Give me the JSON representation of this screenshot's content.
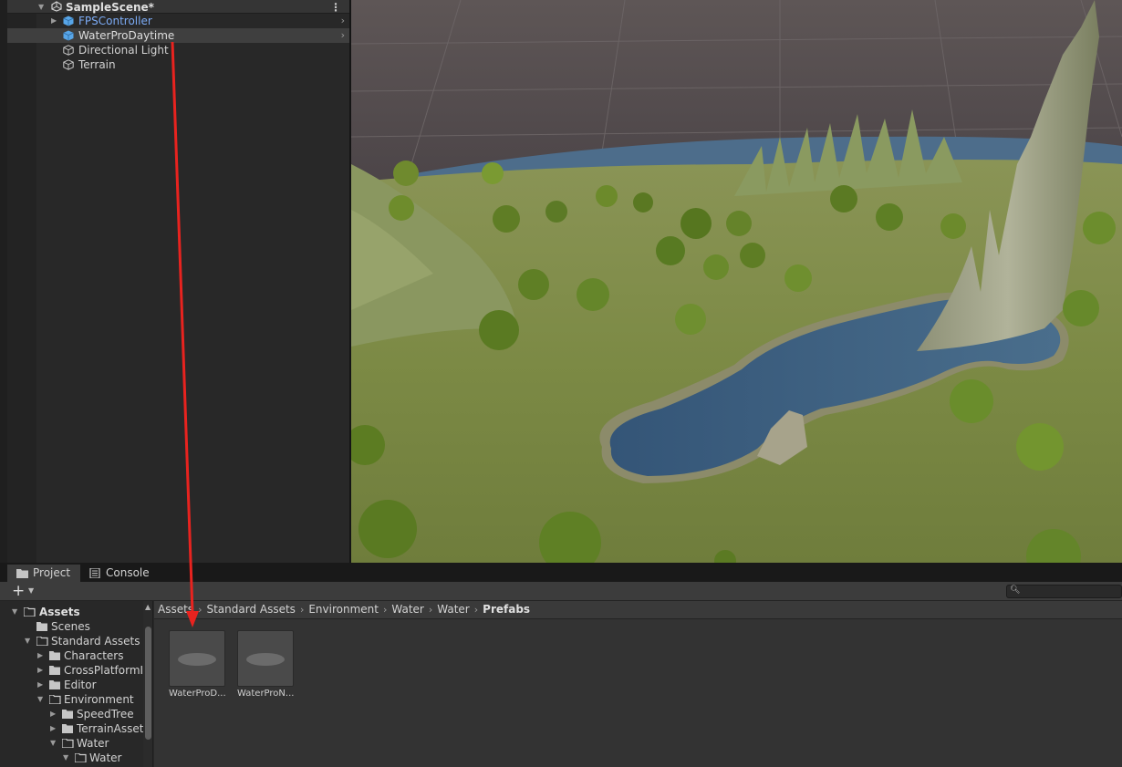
{
  "hierarchy": {
    "scene_name": "SampleScene*",
    "items": [
      {
        "label": "FPSController",
        "kind": "prefab",
        "expandable": true
      },
      {
        "label": "WaterProDaytime",
        "kind": "prefab",
        "expandable": true
      },
      {
        "label": "Directional Light",
        "kind": "gameobject",
        "expandable": false
      },
      {
        "label": "Terrain",
        "kind": "gameobject",
        "expandable": false
      }
    ]
  },
  "bottom_tabs": {
    "project": "Project",
    "console": "Console"
  },
  "toolbar": {
    "add_label": "+"
  },
  "tree": {
    "items": [
      {
        "label": "Assets",
        "bold": true
      },
      {
        "label": "Scenes"
      },
      {
        "label": "Standard Assets"
      },
      {
        "label": "Characters"
      },
      {
        "label": "CrossPlatformIn"
      },
      {
        "label": "Editor"
      },
      {
        "label": "Environment"
      },
      {
        "label": "SpeedTree"
      },
      {
        "label": "TerrainAssets"
      },
      {
        "label": "Water"
      },
      {
        "label": "Water"
      }
    ]
  },
  "breadcrumb": [
    "Assets",
    "Standard Assets",
    "Environment",
    "Water",
    "Water",
    "Prefabs"
  ],
  "assets": [
    {
      "name": "WaterProD..."
    },
    {
      "name": "WaterProN..."
    }
  ],
  "colors": {
    "prefab_text": "#7cabf5",
    "annotation_arrow": "#e8231f",
    "sky": "#4a4446",
    "grass": "#7f8c4a",
    "water": "#3a5a7c"
  }
}
